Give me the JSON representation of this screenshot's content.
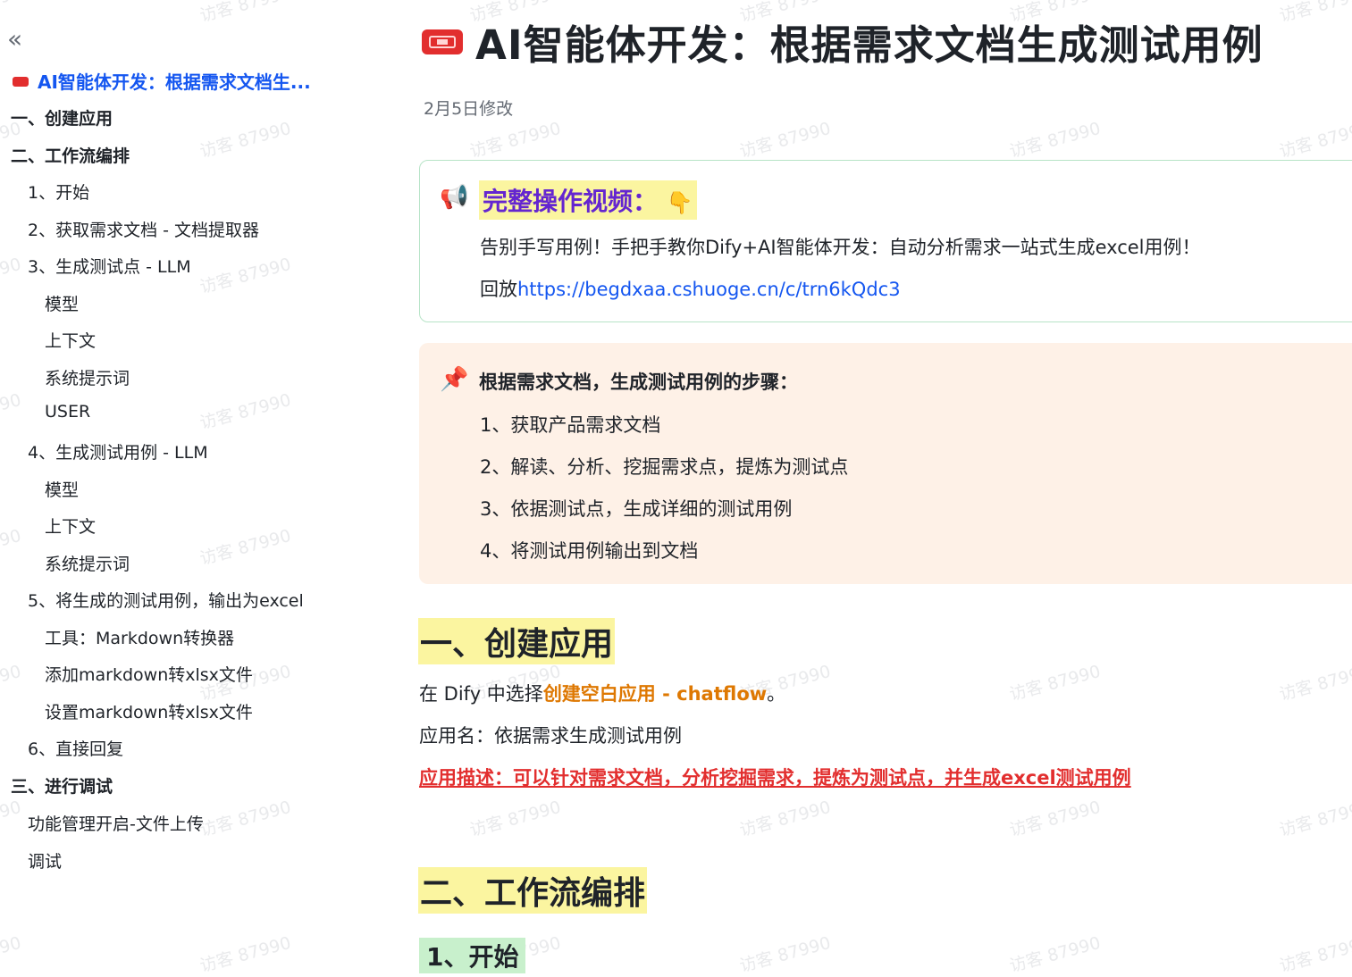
{
  "watermark": "访客 87990",
  "sidebar": {
    "collapse_icon": "double-chevron-left-icon",
    "items": [
      {
        "label": "AI智能体开发：根据需求文档生...",
        "level": "root",
        "active": true
      },
      {
        "label": "一、创建应用",
        "level": "h1"
      },
      {
        "label": "二、工作流编排",
        "level": "h1"
      },
      {
        "label": "1、开始",
        "level": "h2"
      },
      {
        "label": "2、获取需求文档 - 文档提取器",
        "level": "h2"
      },
      {
        "label": "3、生成测试点 - LLM",
        "level": "h2"
      },
      {
        "label": "模型",
        "level": "h3"
      },
      {
        "label": "上下文",
        "level": "h3"
      },
      {
        "label": "系统提示词",
        "level": "h3"
      },
      {
        "label": "USER",
        "level": "h3"
      },
      {
        "label": "4、生成测试用例 - LLM",
        "level": "h2"
      },
      {
        "label": "模型",
        "level": "h3"
      },
      {
        "label": "上下文",
        "level": "h3"
      },
      {
        "label": "系统提示词",
        "level": "h3"
      },
      {
        "label": "5、将生成的测试用例，输出为excel",
        "level": "h2"
      },
      {
        "label": "工具：Markdown转换器",
        "level": "h3"
      },
      {
        "label": "添加markdown转xlsx文件",
        "level": "h3"
      },
      {
        "label": "设置markdown转xlsx文件",
        "level": "h3"
      },
      {
        "label": "6、直接回复",
        "level": "h2"
      },
      {
        "label": "三、进行调试",
        "level": "h1"
      },
      {
        "label": "功能管理开启-文件上传",
        "level": "h2"
      },
      {
        "label": "调试",
        "level": "h2"
      }
    ]
  },
  "doc": {
    "title_icon": "ticket-icon",
    "title": "AI智能体开发：根据需求文档生成测试用例",
    "modified": "2月5日修改",
    "video_callout": {
      "icon": "megaphone-icon",
      "title": "完整操作视频：",
      "pointer_icon": "👇",
      "line1": "告别手写用例！手把手教你Dify+AI智能体开发：自动分析需求一站式生成excel用例！",
      "replay_prefix": "回放",
      "replay_link": "https://begdxaa.cshuoge.cn/c/trn6kQdc3"
    },
    "steps_callout": {
      "icon": "pushpin-icon",
      "title": "根据需求文档，生成测试用例的步骤：",
      "steps": [
        "1、获取产品需求文档",
        "2、解读、分析、挖掘需求点，提炼为测试点",
        "3、依据测试点，生成详细的测试用例",
        "4、将测试用例输出到文档"
      ]
    },
    "section1": {
      "heading": "一、创建应用",
      "line1_prefix": "在 Dify 中选择",
      "line1_highlight": "创建空白应用 - chatflow",
      "line1_suffix": "。",
      "line2": "应用名：依据需求生成测试用例",
      "line3": "应用描述：可以针对需求文档，分析挖掘需求，提炼为测试点，并生成excel测试用例"
    },
    "section2": {
      "heading": "二、工作流编排",
      "sub1": "1、开始"
    }
  }
}
